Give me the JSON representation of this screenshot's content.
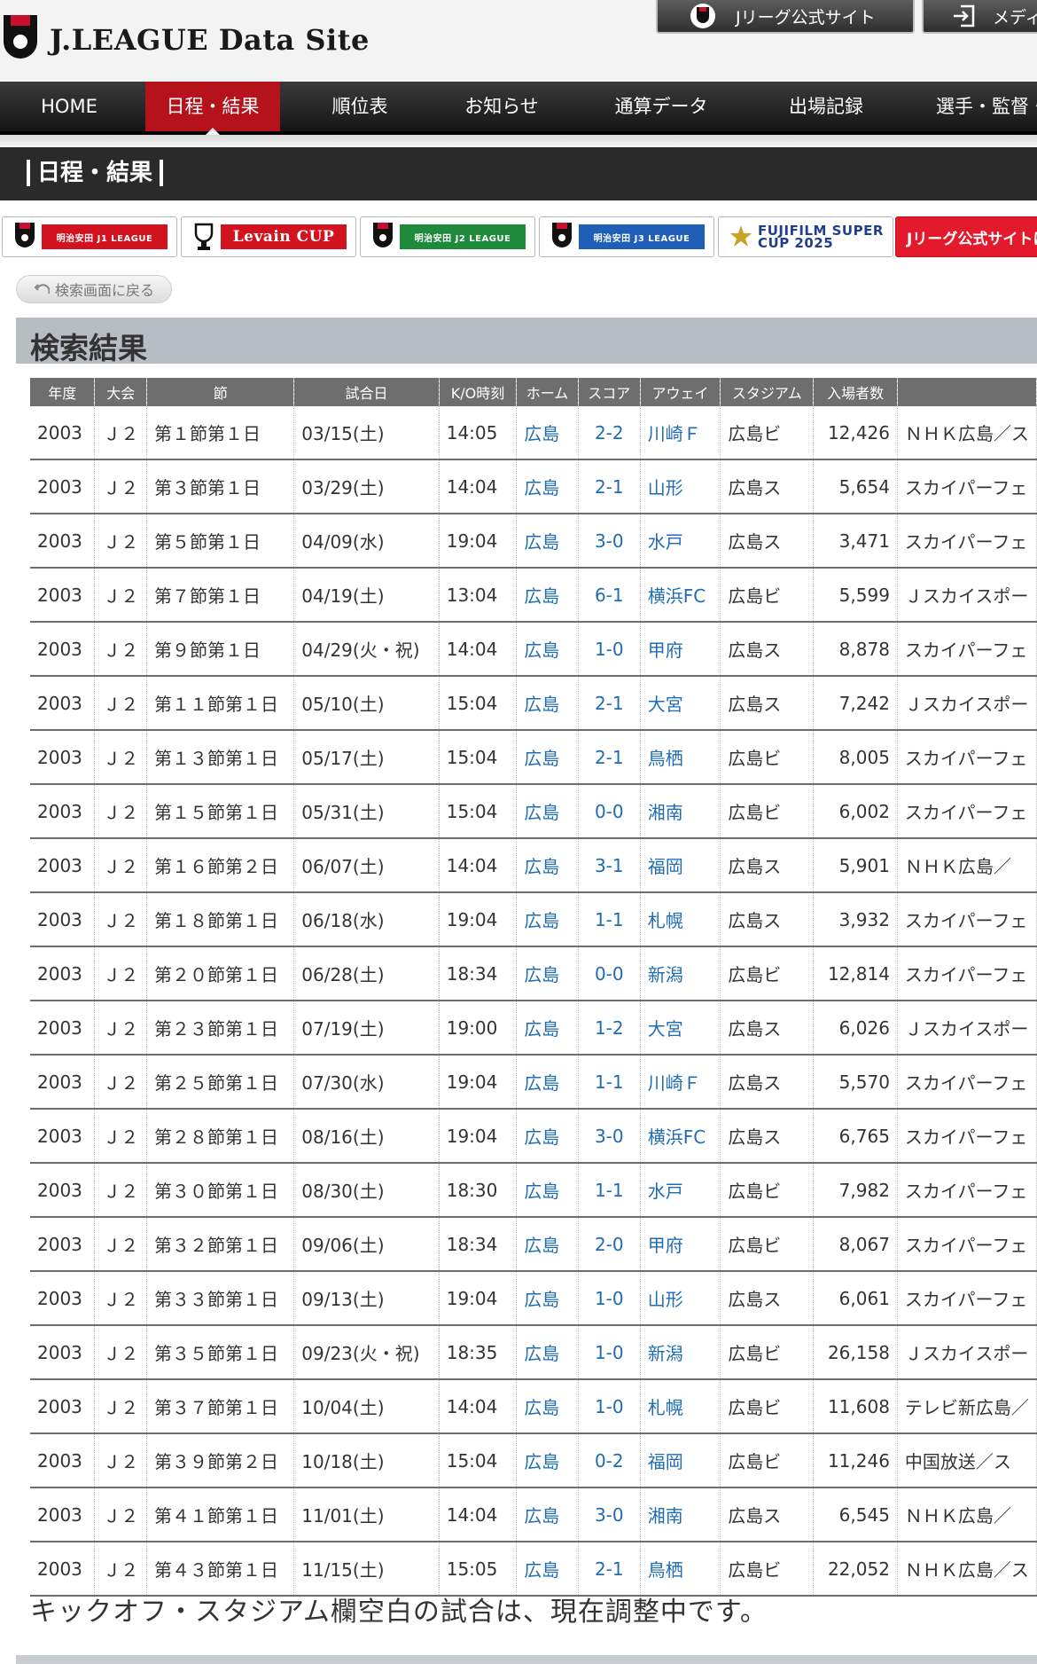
{
  "header": {
    "site_title": "J.LEAGUE Data Site",
    "official_link": "Jリーグ公式サイト",
    "media_link": "メディア"
  },
  "nav": [
    {
      "label": "HOME"
    },
    {
      "label": "日程・結果",
      "active": true
    },
    {
      "label": "順位表"
    },
    {
      "label": "お知らせ"
    },
    {
      "label": "通算データ"
    },
    {
      "label": "出場記録"
    },
    {
      "label": "選手・監督・"
    }
  ],
  "page_title": "日程・結果",
  "banners": [
    {
      "name": "明治安田 J1 LEAGUE",
      "color": "#d3121f"
    },
    {
      "name": "Levain CUP",
      "color": "#d3121f"
    },
    {
      "name": "明治安田 J2 LEAGUE",
      "color": "#1e8a3c"
    },
    {
      "name": "明治安田 J3 LEAGUE",
      "color": "#1f5fb8"
    },
    {
      "name": "FUJIFILM SUPER CUP 2025",
      "color": "#1f3f8a"
    },
    {
      "name": "Jリーグ公式サイトに"
    }
  ],
  "back_button": "検索画面に戻る",
  "results_heading": "検索結果",
  "table": {
    "columns": [
      "年度",
      "大会",
      "節",
      "試合日",
      "K/O時刻",
      "ホーム",
      "スコア",
      "アウェイ",
      "スタジアム",
      "入場者数",
      ""
    ],
    "rows": [
      [
        "2003",
        "Ｊ２",
        "第１節第１日",
        "03/15(土)",
        "14:05",
        "広島",
        "2-2",
        "川崎Ｆ",
        "広島ビ",
        "12,426",
        "ＮＨＫ広島／ス"
      ],
      [
        "2003",
        "Ｊ２",
        "第３節第１日",
        "03/29(土)",
        "14:04",
        "広島",
        "2-1",
        "山形",
        "広島ス",
        "5,654",
        "スカイパーフェ"
      ],
      [
        "2003",
        "Ｊ２",
        "第５節第１日",
        "04/09(水)",
        "19:04",
        "広島",
        "3-0",
        "水戸",
        "広島ス",
        "3,471",
        "スカイパーフェ"
      ],
      [
        "2003",
        "Ｊ２",
        "第７節第１日",
        "04/19(土)",
        "13:04",
        "広島",
        "6-1",
        "横浜FC",
        "広島ビ",
        "5,599",
        "Ｊスカイスポー"
      ],
      [
        "2003",
        "Ｊ２",
        "第９節第１日",
        "04/29(火・祝)",
        "14:04",
        "広島",
        "1-0",
        "甲府",
        "広島ス",
        "8,878",
        "スカイパーフェ"
      ],
      [
        "2003",
        "Ｊ２",
        "第１１節第１日",
        "05/10(土)",
        "15:04",
        "広島",
        "2-1",
        "大宮",
        "広島ス",
        "7,242",
        "Ｊスカイスポー"
      ],
      [
        "2003",
        "Ｊ２",
        "第１３節第１日",
        "05/17(土)",
        "15:04",
        "広島",
        "2-1",
        "鳥栖",
        "広島ビ",
        "8,005",
        "スカイパーフェ"
      ],
      [
        "2003",
        "Ｊ２",
        "第１５節第１日",
        "05/31(土)",
        "15:04",
        "広島",
        "0-0",
        "湘南",
        "広島ビ",
        "6,002",
        "スカイパーフェ"
      ],
      [
        "2003",
        "Ｊ２",
        "第１６節第２日",
        "06/07(土)",
        "14:04",
        "広島",
        "3-1",
        "福岡",
        "広島ス",
        "5,901",
        "ＮＨＫ広島／"
      ],
      [
        "2003",
        "Ｊ２",
        "第１８節第１日",
        "06/18(水)",
        "19:04",
        "広島",
        "1-1",
        "札幌",
        "広島ス",
        "3,932",
        "スカイパーフェ"
      ],
      [
        "2003",
        "Ｊ２",
        "第２０節第１日",
        "06/28(土)",
        "18:34",
        "広島",
        "0-0",
        "新潟",
        "広島ビ",
        "12,814",
        "スカイパーフェ"
      ],
      [
        "2003",
        "Ｊ２",
        "第２３節第１日",
        "07/19(土)",
        "19:00",
        "広島",
        "1-2",
        "大宮",
        "広島ス",
        "6,026",
        "Ｊスカイスポー"
      ],
      [
        "2003",
        "Ｊ２",
        "第２５節第１日",
        "07/30(水)",
        "19:04",
        "広島",
        "1-1",
        "川崎Ｆ",
        "広島ス",
        "5,570",
        "スカイパーフェ"
      ],
      [
        "2003",
        "Ｊ２",
        "第２８節第１日",
        "08/16(土)",
        "19:04",
        "広島",
        "3-0",
        "横浜FC",
        "広島ス",
        "6,765",
        "スカイパーフェ"
      ],
      [
        "2003",
        "Ｊ２",
        "第３０節第１日",
        "08/30(土)",
        "18:30",
        "広島",
        "1-1",
        "水戸",
        "広島ビ",
        "7,982",
        "スカイパーフェ"
      ],
      [
        "2003",
        "Ｊ２",
        "第３２節第１日",
        "09/06(土)",
        "18:34",
        "広島",
        "2-0",
        "甲府",
        "広島ビ",
        "8,067",
        "スカイパーフェ"
      ],
      [
        "2003",
        "Ｊ２",
        "第３３節第１日",
        "09/13(土)",
        "19:04",
        "広島",
        "1-0",
        "山形",
        "広島ス",
        "6,061",
        "スカイパーフェ"
      ],
      [
        "2003",
        "Ｊ２",
        "第３５節第１日",
        "09/23(火・祝)",
        "18:35",
        "広島",
        "1-0",
        "新潟",
        "広島ビ",
        "26,158",
        "Ｊスカイスポー"
      ],
      [
        "2003",
        "Ｊ２",
        "第３７節第１日",
        "10/04(土)",
        "14:04",
        "広島",
        "1-0",
        "札幌",
        "広島ビ",
        "11,608",
        "テレビ新広島／"
      ],
      [
        "2003",
        "Ｊ２",
        "第３９節第２日",
        "10/18(土)",
        "15:04",
        "広島",
        "0-2",
        "福岡",
        "広島ビ",
        "11,246",
        "中国放送／ス"
      ],
      [
        "2003",
        "Ｊ２",
        "第４１節第１日",
        "11/01(土)",
        "14:04",
        "広島",
        "3-0",
        "湘南",
        "広島ス",
        "6,545",
        "ＮＨＫ広島／"
      ],
      [
        "2003",
        "Ｊ２",
        "第４３節第１日",
        "11/15(土)",
        "15:05",
        "広島",
        "2-1",
        "鳥栖",
        "広島ビ",
        "22,052",
        "ＮＨＫ広島／ス"
      ]
    ]
  },
  "note": "キックオフ・スタジアム欄空白の試合は、現在調整中です。",
  "colors": {
    "accent_red": "#b5121b",
    "link_blue": "#1f6cb5",
    "header_gray": "#6e6e6e"
  }
}
